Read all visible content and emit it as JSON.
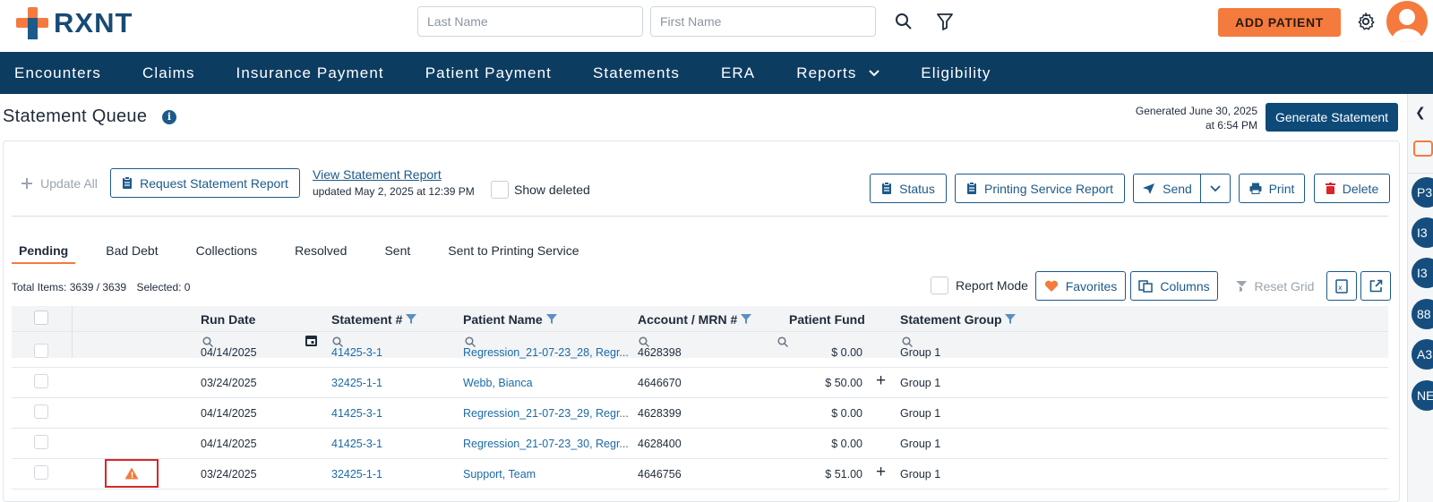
{
  "header": {
    "logo_text": "RXNT",
    "last_name_placeholder": "Last Name",
    "first_name_placeholder": "First Name",
    "add_patient_label": "ADD PATIENT"
  },
  "nav": {
    "items": [
      "Encounters",
      "Claims",
      "Insurance Payment",
      "Patient Payment",
      "Statements",
      "ERA",
      "Reports",
      "Eligibility"
    ]
  },
  "page": {
    "title": "Statement Queue",
    "generated_line1": "Generated June 30, 2025",
    "generated_line2": "at 6:54 PM",
    "generate_button": "Generate Statement"
  },
  "toolbar": {
    "update_all": "Update All",
    "request_report": "Request Statement Report",
    "view_report_link": "View Statement Report",
    "updated_text": "updated May 2, 2025 at 12:39 PM",
    "show_deleted": "Show deleted",
    "status": "Status",
    "printing_service_report": "Printing Service Report",
    "send": "Send",
    "print": "Print",
    "delete": "Delete"
  },
  "tabs": [
    "Pending",
    "Bad Debt",
    "Collections",
    "Resolved",
    "Sent",
    "Sent to Printing Service"
  ],
  "active_tab": "Pending",
  "grid_toolbar": {
    "totals": "Total Items: 3639 / 3639",
    "selected": "Selected: 0",
    "report_mode": "Report Mode",
    "favorites": "Favorites",
    "columns": "Columns",
    "reset_grid": "Reset Grid"
  },
  "columns": {
    "run_date": "Run Date",
    "statement_no": "Statement #",
    "patient_name": "Patient Name",
    "account_mrn": "Account / MRN #",
    "patient_fund": "Patient Fund",
    "statement_group": "Statement Group"
  },
  "rows": [
    {
      "run_date": "04/14/2025",
      "statement_no": "41425-3-1",
      "patient_name": "Regression_21-07-23_28, Regr...",
      "account": "4628398",
      "fund": "$ 0.00",
      "group": "Group 1",
      "plus": "",
      "warn": ""
    },
    {
      "run_date": "03/24/2025",
      "statement_no": "32425-1-1",
      "patient_name": "Webb, Bianca",
      "account": "4646670",
      "fund": "$ 50.00",
      "group": "Group 1",
      "plus": "+",
      "warn": ""
    },
    {
      "run_date": "04/14/2025",
      "statement_no": "41425-3-1",
      "patient_name": "Regression_21-07-23_29, Regr...",
      "account": "4628399",
      "fund": "$ 0.00",
      "group": "Group 1",
      "plus": "",
      "warn": ""
    },
    {
      "run_date": "04/14/2025",
      "statement_no": "41425-3-1",
      "patient_name": "Regression_21-07-23_30, Regr...",
      "account": "4628400",
      "fund": "$ 0.00",
      "group": "Group 1",
      "plus": "",
      "warn": ""
    },
    {
      "run_date": "03/24/2025",
      "statement_no": "32425-1-1",
      "patient_name": "Support, Team",
      "account": "4646756",
      "fund": "$ 51.00",
      "group": "Group 1",
      "plus": "+",
      "warn": "!"
    }
  ],
  "rail": {
    "bubbles": [
      "P3",
      "I3",
      "I3",
      "88",
      "A3",
      "NE"
    ]
  },
  "colors": {
    "brand_orange": "#f47b3d",
    "nav_blue": "#0d3c61",
    "primary_blue": "#0d4a78",
    "link_blue": "#1c6aa6"
  },
  "icons": [
    "search-icon",
    "filter-icon",
    "gear-icon",
    "info-icon",
    "calendar-icon",
    "warning-icon",
    "heart-icon",
    "send-icon",
    "print-icon",
    "trash-icon",
    "clipboard-icon"
  ]
}
